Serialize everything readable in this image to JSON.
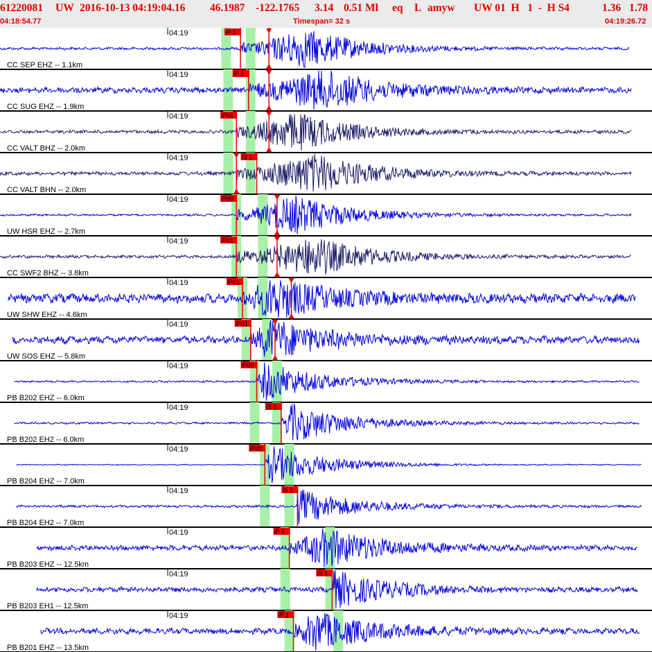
{
  "header": {
    "event_id": "61220081",
    "network": "UW",
    "datetime": "2016-10-13 04:19:04.16",
    "lat": "46.1987",
    "lon": "-122.1765",
    "depth": "3.14",
    "magnitude": "0.51 Ml",
    "etype": "eq",
    "gtype": "L",
    "author": "amyw",
    "tail": "UW 01  H   1  -  H S4",
    "rms": "1.36",
    "gap": "1.78",
    "start_time": "04:18:54.77",
    "timespan": "Timespan=  32 s",
    "end_time": "04:19:26.72"
  },
  "colors": {
    "header_bg": "#ebebeb",
    "header_text": "#e00000",
    "trace_blue": "#0000dd",
    "trace_navy": "#1a1a66",
    "pick_red": "#ee0000",
    "window_green": "#a8f0a8",
    "separator": "#000000"
  },
  "chart_data": {
    "type": "line",
    "title": "",
    "x_unit": "s",
    "x_range": [
      0,
      32
    ],
    "time_tick": {
      "t": 8.23,
      "label": "04:19"
    },
    "traces": [
      {
        "label": "CC SEP EHZ -- 1.1km",
        "color": "blue",
        "start": 0,
        "end": 30.9,
        "amp": 1.6,
        "peak": 15.0,
        "windows": [
          11.1,
          12.3
        ],
        "picks": [
          {
            "t": 11.8,
            "text": "iP 1"
          },
          {
            "t": 13.2,
            "text": ""
          }
        ]
      },
      {
        "label": "CC SUG EHZ -- 1.9km",
        "color": "blue",
        "start": 0,
        "end": 31.0,
        "amp": 3.5,
        "peak": 16.0,
        "windows": [
          11.2,
          12.3
        ],
        "picks": [
          {
            "t": 12.2,
            "text": "iP 1"
          },
          {
            "t": 13.2,
            "text": ""
          }
        ]
      },
      {
        "label": "CC VALT BHZ -- 2.0km",
        "color": "navy",
        "start": 0,
        "end": 31.0,
        "amp": 2.0,
        "peak": 14.5,
        "windows": [
          11.2,
          12.3
        ],
        "picks": [
          {
            "t": 11.6,
            "text": "iPd1"
          },
          {
            "t": 13.2,
            "text": ""
          }
        ]
      },
      {
        "label": "CC VALT BHN -- 2.0km",
        "color": "navy",
        "start": 0,
        "end": 31.0,
        "amp": 2.2,
        "peak": 15.5,
        "windows": [
          11.2,
          12.3
        ],
        "picks": [
          {
            "t": 11.6,
            "text": ""
          },
          {
            "t": 12.6,
            "text": "iS 1"
          }
        ]
      },
      {
        "label": "UW HSR EHZ -- 2.7km",
        "color": "blue",
        "start": 0,
        "end": 31.0,
        "amp": 1.2,
        "peak": 14.5,
        "windows": [
          11.6,
          12.9
        ],
        "picks": [
          {
            "t": 11.6,
            "text": "iPd0"
          },
          {
            "t": 13.6,
            "text": ""
          }
        ]
      },
      {
        "label": "CC SWF2 BHZ -- 3.8km",
        "color": "navy",
        "start": 0,
        "end": 31.0,
        "amp": 1.8,
        "peak": 15.5,
        "windows": [
          11.6,
          12.9
        ],
        "picks": [
          {
            "t": 11.6,
            "text": "iPc1"
          },
          {
            "t": 13.6,
            "text": ""
          }
        ]
      },
      {
        "label": "UW SHW EHZ -- 4.6km",
        "color": "blue",
        "start": 0.4,
        "end": 31.2,
        "amp": 5.5,
        "peak": 13.5,
        "windows": [
          11.9,
          12.9
        ],
        "picks": [
          {
            "t": 11.9,
            "text": "iPc1"
          },
          {
            "t": 14.3,
            "text": ""
          }
        ]
      },
      {
        "label": "UW SOS EHZ -- 5.8km",
        "color": "blue",
        "start": 0.6,
        "end": 31.4,
        "amp": 4.5,
        "peak": 13.3,
        "windows": [
          12.1,
          13.1
        ],
        "picks": [
          {
            "t": 12.3,
            "text": "iPd1"
          },
          {
            "t": 13.5,
            "text": ""
          }
        ]
      },
      {
        "label": "PB B202 EHZ -- 6.0km",
        "color": "blue",
        "start": 0.7,
        "end": 31.4,
        "amp": 1.2,
        "peak": 13.0,
        "windows": [
          12.5,
          13.6
        ],
        "picks": [
          {
            "t": 12.6,
            "text": "iPd0"
          }
        ]
      },
      {
        "label": "PB B202 EH2 -- 6.0km",
        "color": "blue",
        "start": 0.7,
        "end": 31.4,
        "amp": 1.2,
        "peak": 14.3,
        "windows": [
          12.5,
          13.6
        ],
        "picks": [
          {
            "t": 13.8,
            "text": "iS 1"
          }
        ]
      },
      {
        "label": "PB B204 EHZ -- 7.0km",
        "color": "blue",
        "start": 0.8,
        "end": 31.5,
        "amp": 0.6,
        "peak": 13.3,
        "windows": [
          13.0,
          14.2
        ],
        "picks": [
          {
            "t": 13.0,
            "text": "iPd0"
          }
        ]
      },
      {
        "label": "PB B204 EH2 -- 7.0km",
        "color": "blue",
        "start": 0.8,
        "end": 31.5,
        "amp": 1.5,
        "peak": 14.3,
        "windows": [
          13.0,
          14.2
        ],
        "picks": [
          {
            "t": 14.6,
            "text": "iS 1"
          }
        ]
      },
      {
        "label": "PB B203 EHZ -- 12.5km",
        "color": "blue",
        "start": 1.8,
        "end": 31.3,
        "amp": 3.2,
        "peak": 16.0,
        "windows": [
          14.0,
          16.2
        ],
        "picks": [
          {
            "t": 14.2,
            "text": "iP 1"
          }
        ]
      },
      {
        "label": "PB B203 EH1 -- 12.5km",
        "color": "blue",
        "start": 1.8,
        "end": 31.3,
        "amp": 3.0,
        "peak": 16.2,
        "windows": [
          14.0,
          16.2
        ],
        "picks": [
          {
            "t": 16.3,
            "text": "iS 1"
          }
        ]
      },
      {
        "label": "PB B201 EHZ -- 13.5km",
        "color": "blue",
        "start": 2.0,
        "end": 31.4,
        "amp": 3.5,
        "peak": 15.5,
        "windows": [
          14.2,
          16.6
        ],
        "picks": [
          {
            "t": 14.4,
            "text": "iP 1"
          }
        ]
      }
    ]
  }
}
